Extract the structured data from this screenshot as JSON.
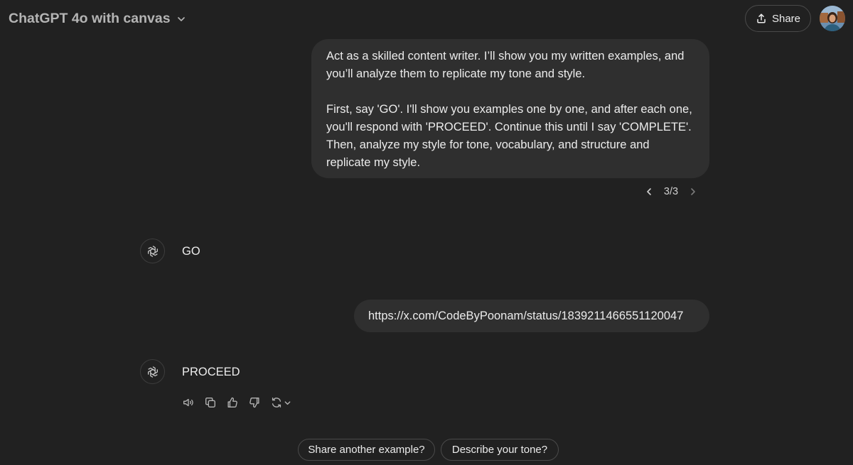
{
  "header": {
    "model_title": "ChatGPT 4o with canvas",
    "share_label": "Share"
  },
  "messages": {
    "user_1": {
      "paragraph_1": "Act as a skilled content writer. I’ll show you my written examples, and you’ll analyze them to replicate my tone and style.",
      "paragraph_2": "First, say 'GO'. I'll show you examples one by one, and after each one, you'll respond with 'PROCEED'. Continue this until I say 'COMPLETE'. Then, analyze my style for tone, vocabulary, and structure and replicate my style.",
      "pager": "3/3"
    },
    "assistant_1": {
      "text": "GO"
    },
    "user_2": {
      "text": "https://x.com/CodeByPoonam/status/1839211466551120047"
    },
    "assistant_2": {
      "text": "PROCEED"
    }
  },
  "suggestions": [
    "Share another example?",
    "Describe your tone?"
  ],
  "icons": {
    "model_chevron": "chevron-down-icon",
    "share": "share-upload-icon",
    "assistant": "openai-logo-icon",
    "read_aloud": "speaker-icon",
    "copy": "copy-icon",
    "like": "thumbs-up-icon",
    "dislike": "thumbs-down-icon",
    "regenerate": "refresh-icon"
  },
  "colors": {
    "background": "#212121",
    "bubble": "#2f2f2f",
    "text": "#ececec",
    "muted": "#b4b4b4"
  }
}
